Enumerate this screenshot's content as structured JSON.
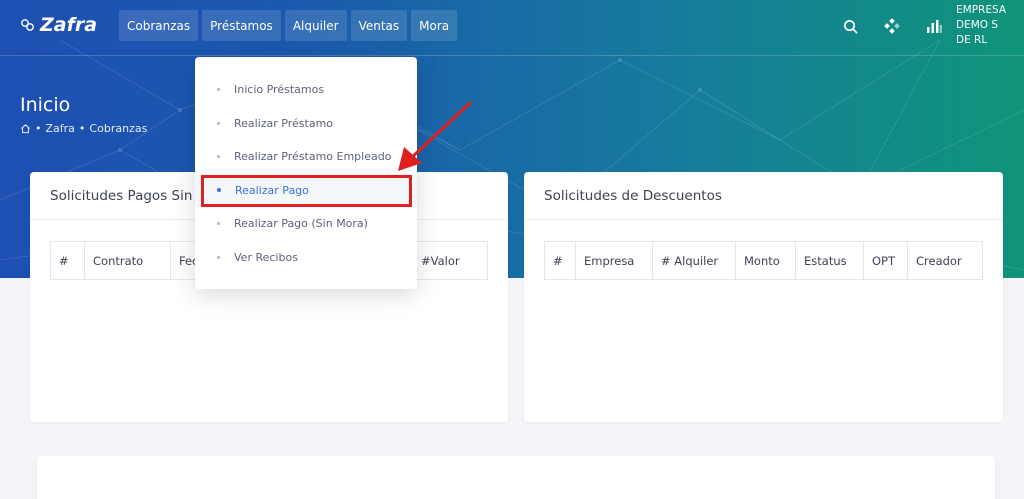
{
  "app": {
    "logo_text": "Zafra",
    "company": "EMPRESA DEMO S DE RL"
  },
  "nav": {
    "items": [
      {
        "label": "Cobranzas"
      },
      {
        "label": "Préstamos"
      },
      {
        "label": "Alquiler"
      },
      {
        "label": "Ventas"
      },
      {
        "label": "Mora"
      }
    ]
  },
  "top_icons": [
    "search-icon",
    "apps-icon",
    "chart-icon"
  ],
  "page": {
    "title": "Inicio",
    "breadcrumb": {
      "home_icon": "home-icon",
      "items": [
        "Zafra",
        "Cobranzas"
      ],
      "separator": "•"
    }
  },
  "dropdown": {
    "items": [
      {
        "label": "Inicio Préstamos",
        "active": false
      },
      {
        "label": "Realizar Préstamo",
        "active": false
      },
      {
        "label": "Realizar Préstamo Empleado",
        "active": false
      },
      {
        "label": "Realizar Pago",
        "active": true
      },
      {
        "label": "Realizar Pago (Sin Mora)",
        "active": false
      },
      {
        "label": "Ver Recibos",
        "active": false
      }
    ]
  },
  "card_pagos": {
    "title": "Solicitudes Pagos Sin M",
    "columns": [
      "#",
      "Contrato",
      "Fec",
      "",
      "#Valor"
    ]
  },
  "card_descuentos": {
    "title": "Solicitudes de Descuentos",
    "columns": [
      "#",
      "Empresa",
      "# Alquiler",
      "Monto",
      "Estatus",
      "OPT",
      "Creador"
    ]
  },
  "colors": {
    "gradient_start": "#1e4fb3",
    "gradient_end": "#0f9479",
    "active_item": "#3e6fd8",
    "highlight": "#e0201e"
  }
}
